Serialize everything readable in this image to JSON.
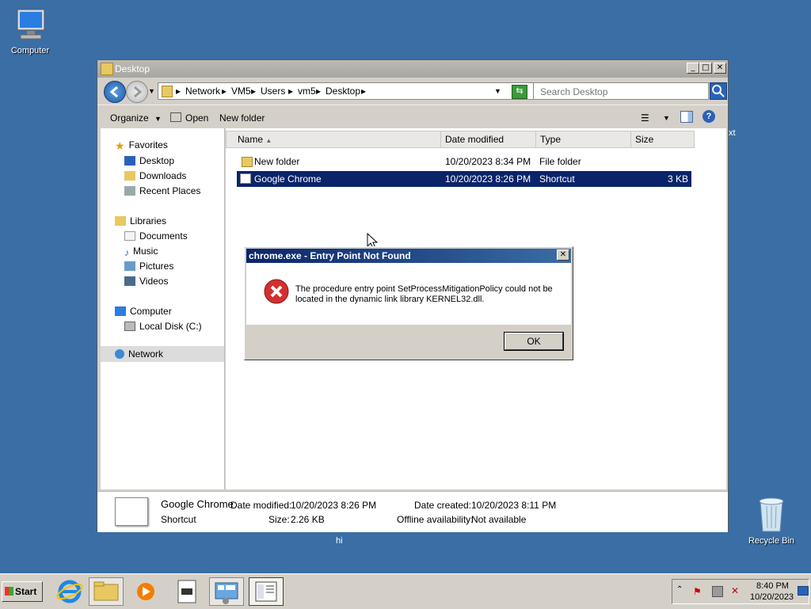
{
  "desktop": {
    "computer_label": "Computer",
    "recycle_label": "Recycle Bin",
    "stray_text_hi": "hi",
    "stray_text_xt": "xt"
  },
  "window": {
    "title": "Desktop",
    "breadcrumb": [
      "Network",
      "VM5",
      "Users",
      "vm5",
      "Desktop"
    ],
    "search_placeholder": "Search Desktop",
    "toolbar": {
      "organize": "Organize",
      "open": "Open",
      "new_folder": "New folder"
    }
  },
  "navpane": {
    "favorites": {
      "label": "Favorites",
      "items": [
        "Desktop",
        "Downloads",
        "Recent Places"
      ]
    },
    "libraries": {
      "label": "Libraries",
      "items": [
        "Documents",
        "Music",
        "Pictures",
        "Videos"
      ]
    },
    "computer": {
      "label": "Computer",
      "items": [
        "Local Disk (C:)"
      ]
    },
    "network": {
      "label": "Network"
    }
  },
  "files": {
    "columns": [
      "Name",
      "Date modified",
      "Type",
      "Size"
    ],
    "rows": [
      {
        "name": "New folder",
        "date": "10/20/2023 8:34 PM",
        "type": "File folder",
        "size": ""
      },
      {
        "name": "Google Chrome",
        "date": "10/20/2023 8:26 PM",
        "type": "Shortcut",
        "size": "3 KB"
      }
    ]
  },
  "details": {
    "name": "Google Chrome",
    "kind": "Shortcut",
    "date_modified_label": "Date modified:",
    "date_modified": "10/20/2023 8:26 PM",
    "size_label": "Size:",
    "size": "2.26 KB",
    "date_created_label": "Date created:",
    "date_created": "10/20/2023 8:11 PM",
    "offline_label": "Offline availability:",
    "offline": "Not available"
  },
  "dialog": {
    "title": "chrome.exe - Entry Point Not Found",
    "line1": "The procedure entry point SetProcessMitigationPolicy could not be",
    "line2": "located in the dynamic link library KERNEL32.dll.",
    "ok_label": "OK"
  },
  "taskbar": {
    "start_label": "Start",
    "time": "8:40 PM",
    "date": "10/20/2023"
  },
  "colors": {
    "desktop": "#3a6ea5",
    "selection": "#0a246a",
    "error": "#d32f2f"
  }
}
